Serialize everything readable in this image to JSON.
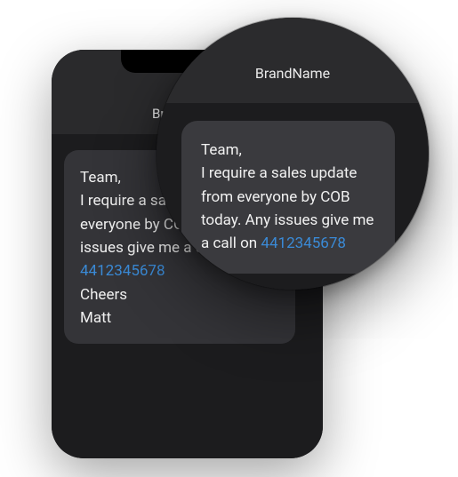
{
  "phone": {
    "header_title": "BrandName",
    "message": {
      "greeting": "Team,",
      "body_prefix": "I require a sales update from everyone by COB today. Any issues give me a call on ",
      "phone_number": "4412345678",
      "signoff": "Cheers",
      "sender": "Matt"
    }
  },
  "magnifier": {
    "header_title": "BrandName",
    "message": {
      "greeting": "Team,",
      "body_prefix": "I require a sales update from everyone by COB today. Any issues give me a call on ",
      "phone_number": "4412345678"
    }
  }
}
